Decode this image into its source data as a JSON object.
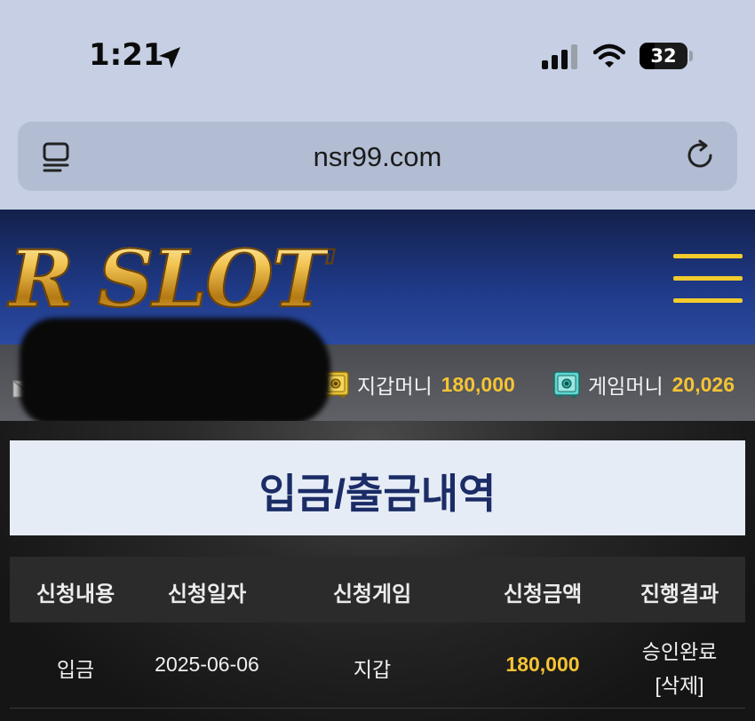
{
  "status_bar": {
    "time": "1:21",
    "battery": "32"
  },
  "browser": {
    "url": "nsr99.com"
  },
  "header": {
    "logo": "R SLOT"
  },
  "wallet": {
    "wallet_label": "지갑머니",
    "wallet_amount": "180,000",
    "game_label": "게임머니",
    "game_amount": "20,026"
  },
  "page": {
    "title": "입금/출금내역"
  },
  "table": {
    "headers": [
      "신청내용",
      "신청일자",
      "신청게임",
      "신청금액",
      "진행결과"
    ],
    "rows": [
      {
        "type": "입금",
        "date": "2025-06-06",
        "game": "지갑",
        "amount": "180,000",
        "status": "승인완료",
        "action": "[삭제]"
      }
    ]
  },
  "colors": {
    "accent_gold": "#f5c334",
    "header_blue": "#1f3a88",
    "title_navy": "#1b2c66"
  }
}
